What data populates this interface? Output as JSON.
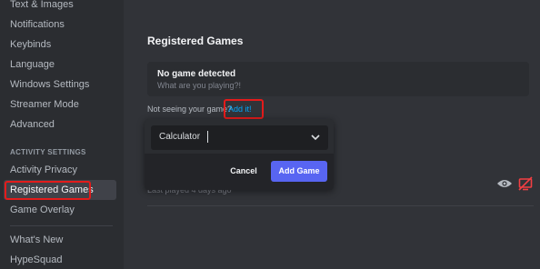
{
  "sidebar": {
    "items_top": [
      {
        "label": "Text & Images"
      },
      {
        "label": "Notifications"
      },
      {
        "label": "Keybinds"
      },
      {
        "label": "Language"
      },
      {
        "label": "Windows Settings"
      },
      {
        "label": "Streamer Mode"
      },
      {
        "label": "Advanced"
      }
    ],
    "section_header": "ACTIVITY SETTINGS",
    "activity_items": [
      {
        "label": "Activity Privacy"
      },
      {
        "label": "Registered Games",
        "selected": true
      },
      {
        "label": "Game Overlay"
      }
    ],
    "bottom_items": [
      {
        "label": "What's New"
      },
      {
        "label": "HypeSquad"
      }
    ]
  },
  "main": {
    "title": "Registered Games",
    "no_game": {
      "title": "No game detected",
      "subtitle": "What are you playing?!"
    },
    "not_seeing_text": "Not seeing your game?",
    "add_link": "Add it!",
    "game_row": {
      "last_played": "Last played 4 days ago",
      "icons": [
        "eye-icon",
        "overlay-disabled-icon"
      ]
    }
  },
  "add_game_popup": {
    "selected_value": "Calculator",
    "cancel_label": "Cancel",
    "add_label": "Add Game"
  },
  "colors": {
    "background": "#313338",
    "sidebar": "#2b2d31",
    "accent": "#5865f2",
    "link": "#00a8fc",
    "highlight": "#e31b1b",
    "danger_icon": "#f23f43"
  }
}
